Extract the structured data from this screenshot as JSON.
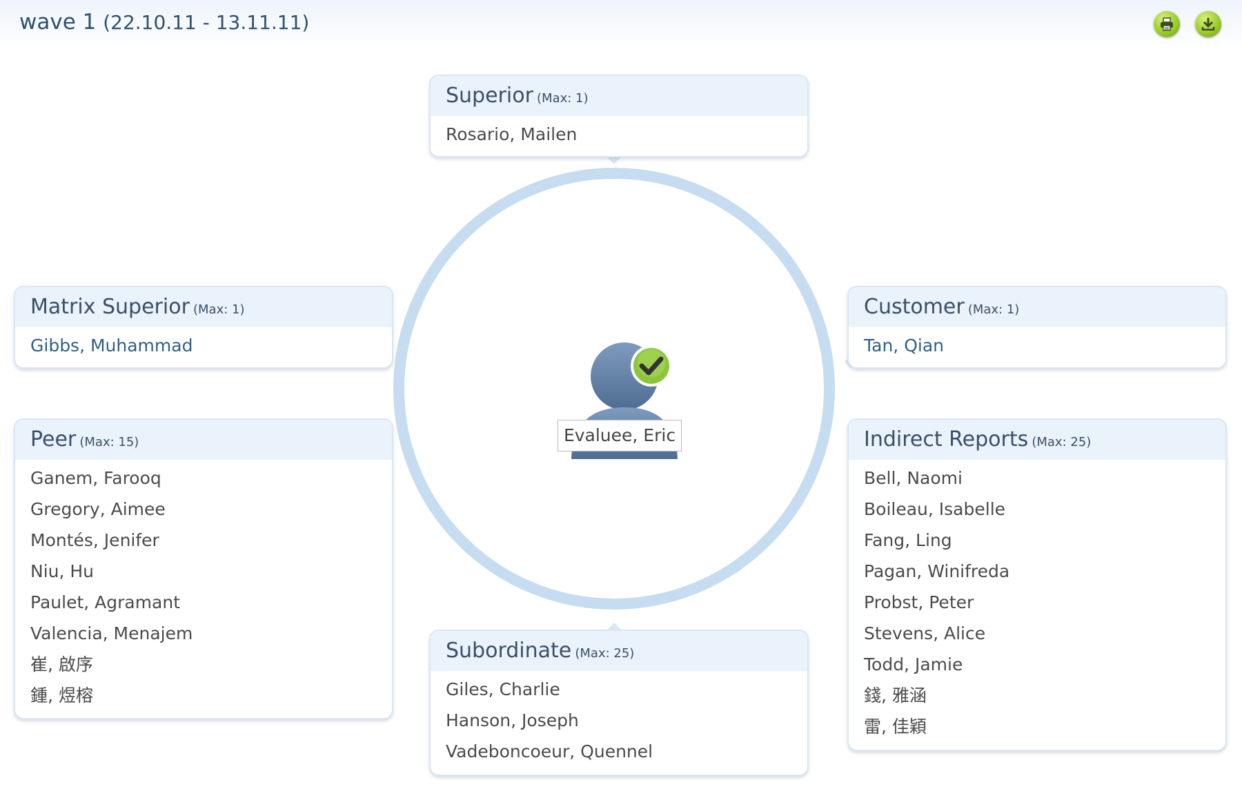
{
  "header": {
    "title": "wave 1",
    "dates": "(22.10.11 - 13.11.11)"
  },
  "toolbar": {
    "print_icon": "printer-icon",
    "download_icon": "download-icon",
    "accent": "#9ccc2a"
  },
  "center": {
    "name": "Evaluee, Eric",
    "avatar_icon": "person-avatar-icon",
    "badge_icon": "checkmark-badge-icon",
    "ring_color": "#c6dcf0"
  },
  "groups": {
    "superior": {
      "title": "Superior",
      "max": "(Max: 1)",
      "members": [
        "Rosario, Mailen"
      ]
    },
    "matrix_superior": {
      "title": "Matrix Superior",
      "max": "(Max: 1)",
      "members": [
        "Gibbs, Muhammad"
      ]
    },
    "customer": {
      "title": "Customer",
      "max": "(Max: 1)",
      "members": [
        "Tan, Qian"
      ]
    },
    "peer": {
      "title": "Peer",
      "max": "(Max: 15)",
      "members": [
        "Ganem, Farooq",
        "Gregory, Aimee",
        "Montés, Jenifer",
        "Niu, Hu",
        "Paulet, Agramant",
        "Valencia, Menajem",
        "崔, 啟序",
        "鍾, 煜榕"
      ]
    },
    "indirect_reports": {
      "title": "Indirect Reports",
      "max": "(Max: 25)",
      "members": [
        "Bell, Naomi",
        "Boileau, Isabelle",
        "Fang, Ling",
        "Pagan, Winifreda",
        "Probst, Peter",
        "Stevens, Alice",
        "Todd, Jamie",
        "錢, 雅涵",
        "雷, 佳穎"
      ]
    },
    "subordinate": {
      "title": "Subordinate",
      "max": "(Max: 25)",
      "members": [
        "Giles, Charlie",
        "Hanson, Joseph",
        "Vadeboncoeur, Quennel"
      ]
    }
  }
}
